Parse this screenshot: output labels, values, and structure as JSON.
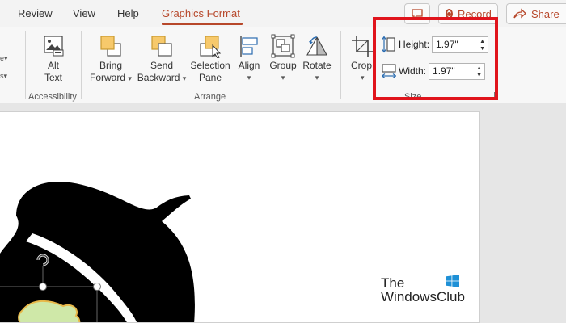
{
  "tabs": [
    {
      "label": "Review"
    },
    {
      "label": "View"
    },
    {
      "label": "Help"
    },
    {
      "label": "Graphics Format",
      "active": true
    }
  ],
  "header_buttons": {
    "record": "Record",
    "share": "Share"
  },
  "ribbon": {
    "groups": {
      "accessibility": {
        "label": "Accessibility",
        "alt_text": {
          "line1": "Alt",
          "line2": "Text"
        }
      },
      "arrange": {
        "label": "Arrange",
        "bring_forward": {
          "line1": "Bring",
          "line2": "Forward"
        },
        "send_backward": {
          "line1": "Send",
          "line2": "Backward"
        },
        "selection_pane": {
          "line1": "Selection",
          "line2": "Pane"
        },
        "align": "Align",
        "group": "Group",
        "rotate": "Rotate"
      },
      "size": {
        "label": "Size",
        "crop": "Crop",
        "height_label": "Height:",
        "height_value": "1.97\"",
        "width_label": "Width:",
        "width_value": "1.97\""
      }
    }
  },
  "watermark": {
    "line1": "The",
    "line2": "WindowsClub"
  },
  "colors": {
    "accent": "#b7472a",
    "highlight": "#e0141c"
  }
}
